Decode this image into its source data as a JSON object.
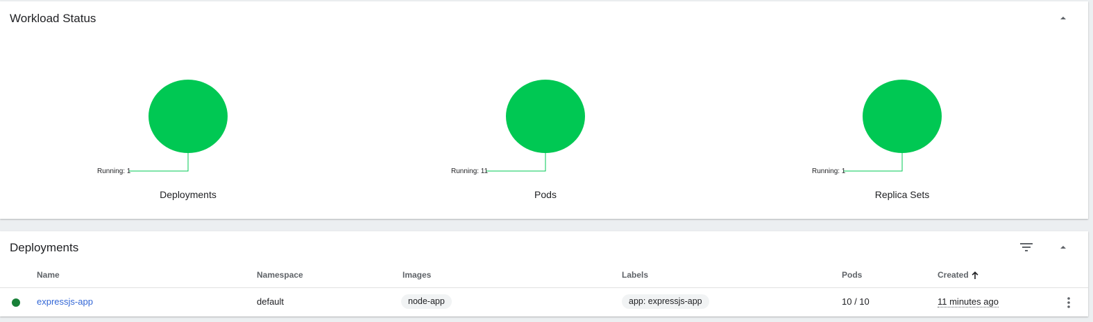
{
  "workload_status": {
    "title": "Workload Status",
    "charts": [
      {
        "name": "Deployments",
        "running_label": "Running: 1",
        "running": 1
      },
      {
        "name": "Pods",
        "running_label": "Running: 11",
        "running": 11
      },
      {
        "name": "Replica Sets",
        "running_label": "Running: 1",
        "running": 1
      }
    ],
    "colors": {
      "running": "#00c853"
    }
  },
  "deployments": {
    "title": "Deployments",
    "columns": {
      "name": "Name",
      "namespace": "Namespace",
      "images": "Images",
      "labels": "Labels",
      "pods": "Pods",
      "created": "Created"
    },
    "sort_icon": "arrow-up-icon",
    "rows": [
      {
        "status": "running",
        "name": "expressjs-app",
        "namespace": "default",
        "image": "node-app",
        "label": "app: expressjs-app",
        "pods": "10 / 10",
        "created": "11 minutes ago"
      }
    ],
    "icons": {
      "filter": "filter-icon",
      "collapse": "chevron-up-icon",
      "menu": "more-vert-icon"
    },
    "colors": {
      "link": "#3367d6",
      "status_running": "#188038"
    }
  }
}
